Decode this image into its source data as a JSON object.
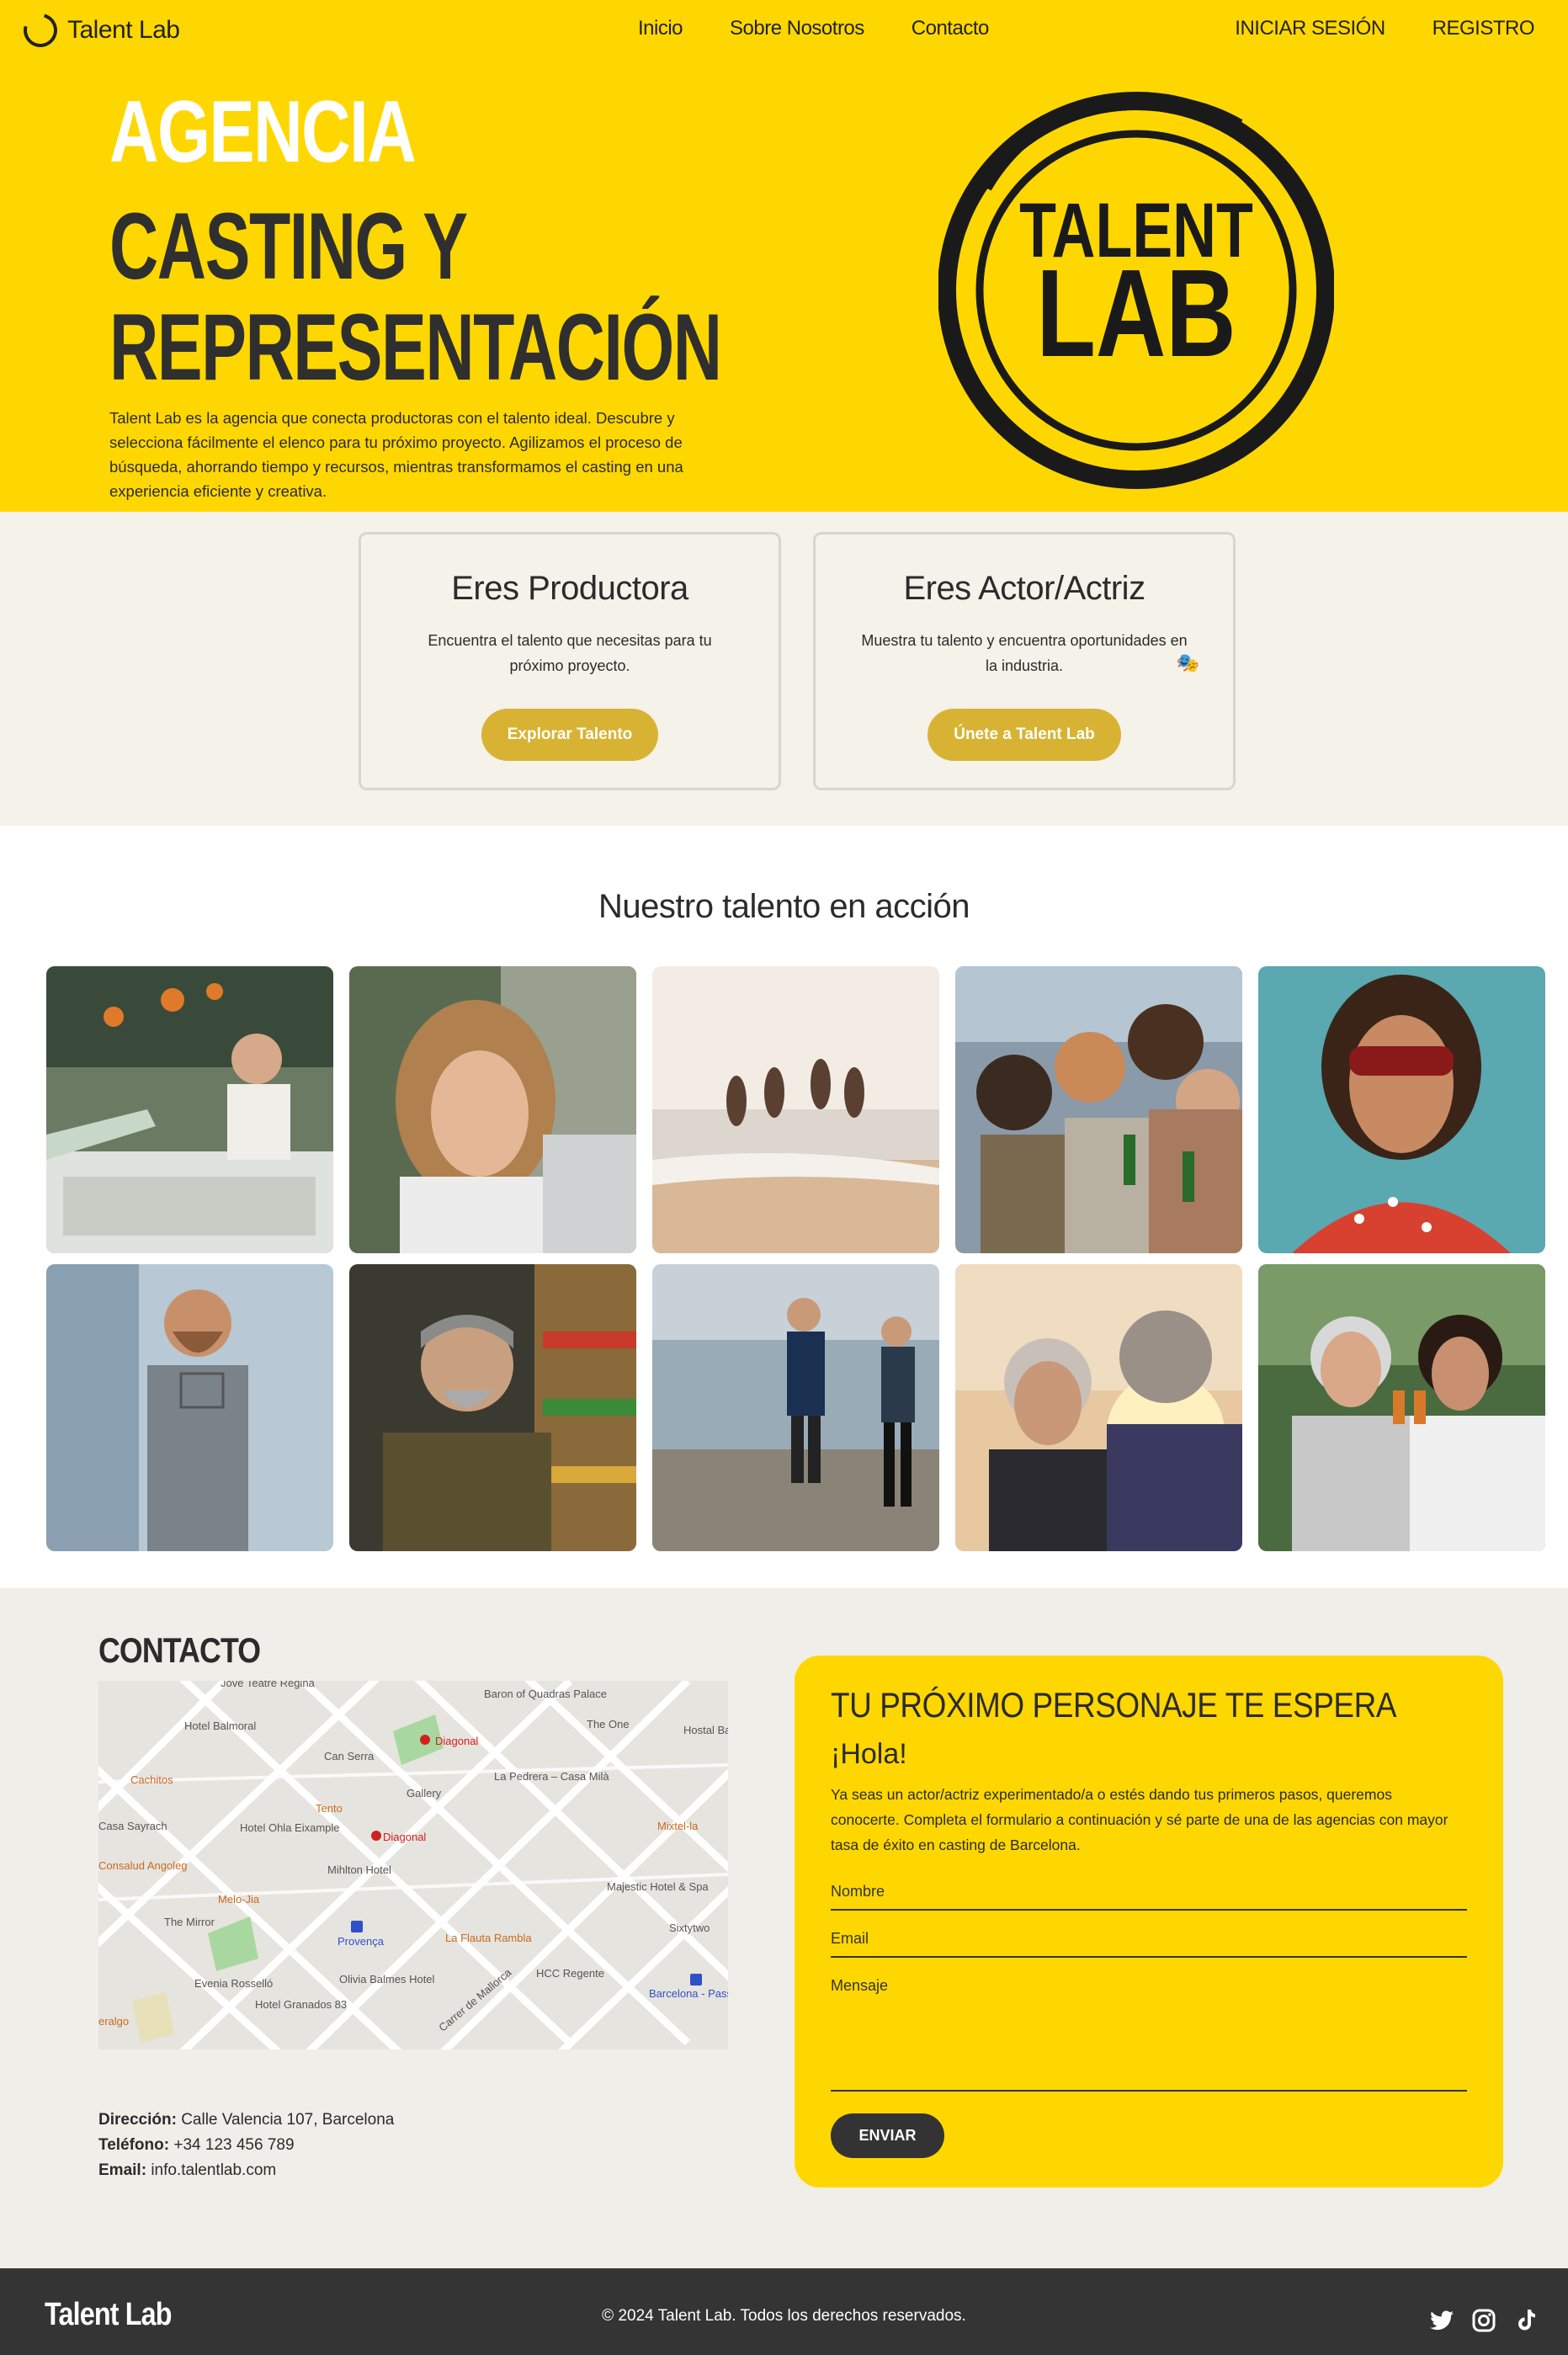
{
  "nav": {
    "brand": "Talent Lab",
    "links": [
      "Inicio",
      "Sobre Nosotros",
      "Contacto"
    ],
    "login": "INICIAR SESIÓN",
    "register": "REGISTRO"
  },
  "hero": {
    "title_line1": "AGENCIA",
    "title_line2": "CASTING Y",
    "title_line3": "REPRESENTACIÓN",
    "description": "Talent Lab es la agencia que conecta productoras con el talento ideal. Descubre y selecciona fácilmente el elenco para tu próximo proyecto. Agilizamos el proceso de búsqueda, ahorrando tiempo y recursos, mientras transformamos el casting en una experiencia eficiente y creativa.",
    "logo_line1": "TALENT",
    "logo_line2": "LAB"
  },
  "cards": [
    {
      "title": "Eres Productora",
      "text": "Encuentra el talento que necesitas para tu próximo proyecto.",
      "button": "Explorar Talento"
    },
    {
      "title": "Eres Actor/Actriz",
      "text": "Muestra tu talento y encuentra oportunidades en la industria.",
      "button": "Únete a Talent Lab",
      "icon": "theater-mask-icon"
    }
  ],
  "gallery": {
    "title": "Nuestro talento en acción"
  },
  "contact": {
    "title": "CONTACTO",
    "map_labels": [
      "Jove Teatre Regina",
      "Baron of Quadras Palace",
      "Hotel Balmoral",
      "The One",
      "Hostal Bar Khro",
      "Can Serra",
      "Diagonal",
      "Cachitos",
      "Tento",
      "Gallery",
      "La Pedrera – Casa Milà",
      "Casa Sayrach",
      "Hotel Ohla Eixample",
      "Diagonal",
      "Mixtel-la",
      "Consalud Angoleg",
      "Mihlton Hotel",
      "Melo-Jia",
      "Majestic Hotel & Spa",
      "The Mirror",
      "Provença",
      "La Flauta Rambla",
      "Sixtytwo",
      "Evenia Rosselló",
      "Olivia Balmes Hotel",
      "HCC Regente",
      "Barcelona - Passeig de Gr",
      "Hotel Granados 83",
      "Carrer de Mallorca",
      "eralgo"
    ],
    "address_label": "Dirección:",
    "address": "Calle Valencia 107, Barcelona",
    "phone_label": "Teléfono:",
    "phone": "+34 123 456 789",
    "email_label": "Email:",
    "email": "info.talentlab.com"
  },
  "form": {
    "title": "TU PRÓXIMO PERSONAJE TE ESPERA",
    "hello": "¡Hola!",
    "description": "Ya seas un actor/actriz experimentado/a o estés dando tus primeros pasos, queremos conocerte. Completa el formulario a continuación y sé parte de una de las agencias con mayor tasa de éxito en casting de Barcelona.",
    "name_placeholder": "Nombre",
    "email_placeholder": "Email",
    "message_placeholder": "Mensaje",
    "submit": "ENVIAR"
  },
  "footer": {
    "brand": "Talent Lab",
    "copyright": "© 2024 Talent Lab. Todos los derechos reservados.",
    "social_icons": [
      "twitter-icon",
      "instagram-icon",
      "tiktok-icon"
    ]
  },
  "colors": {
    "brand_yellow": "#ffd700",
    "button_gold": "#d8b333",
    "dark": "#2b2b2b",
    "footer_bg": "#343434",
    "section_beige": "#f5f2ea"
  }
}
